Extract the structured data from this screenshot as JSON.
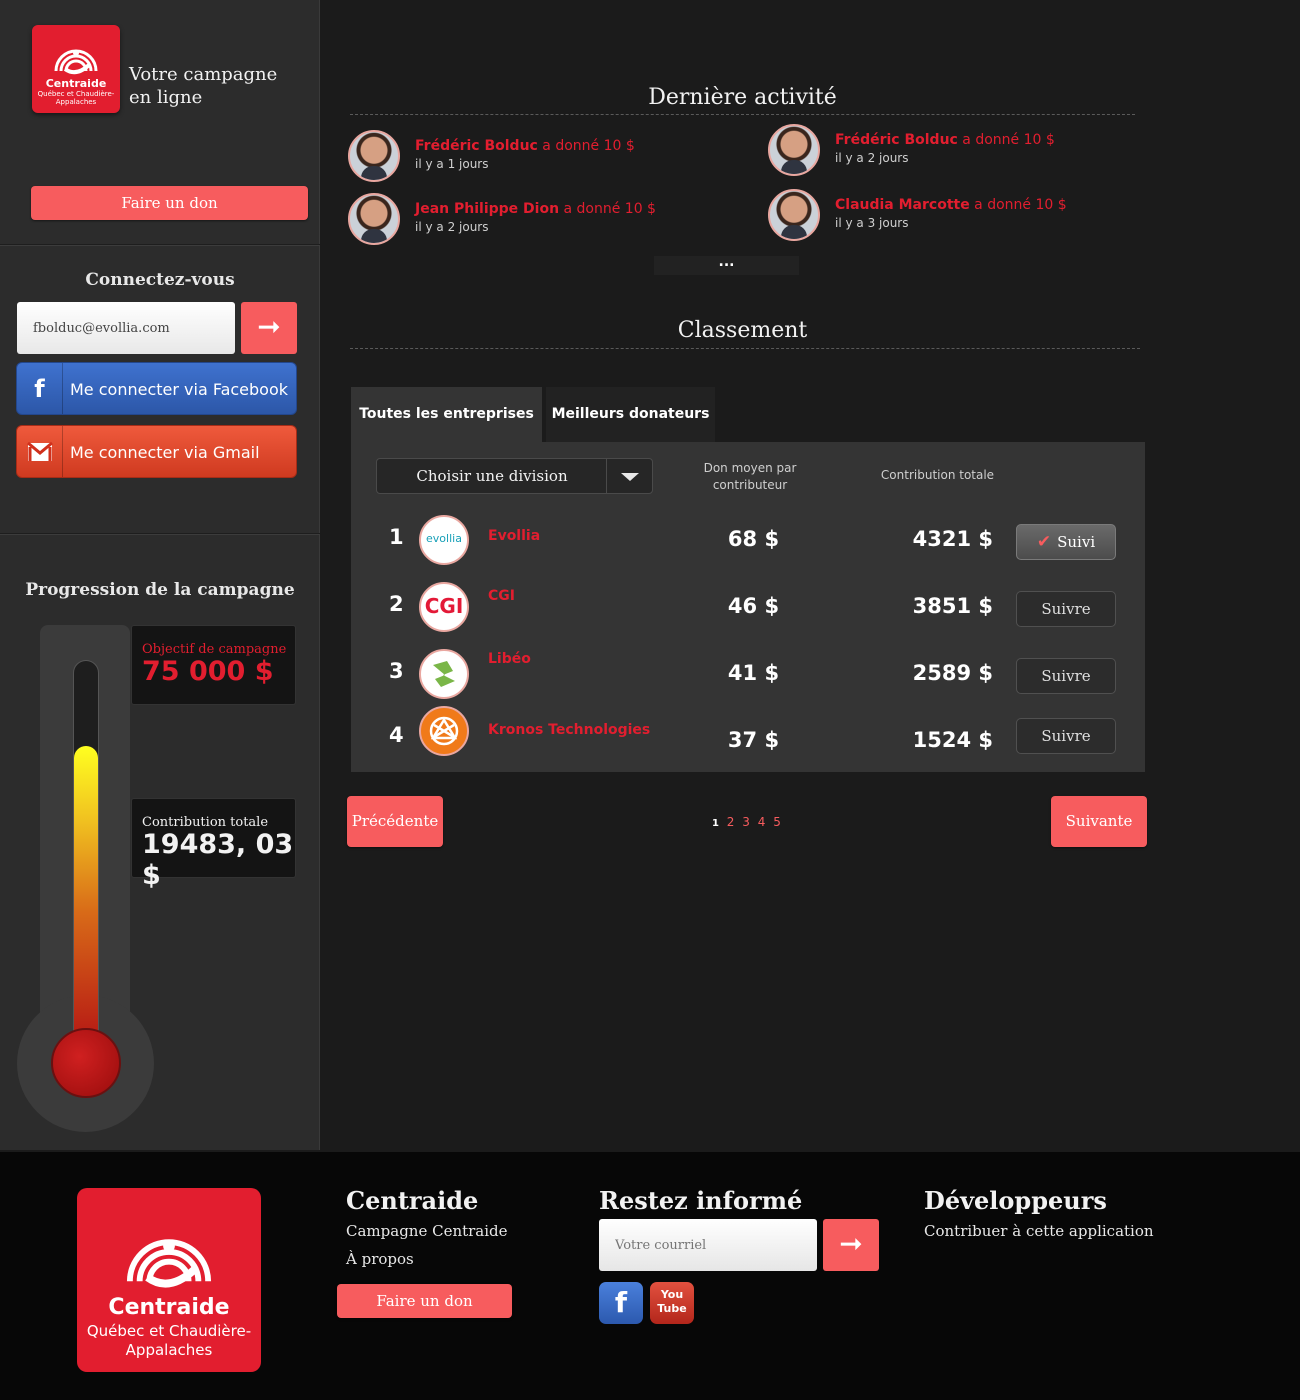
{
  "sidebar": {
    "logo": {
      "brand": "Centraide",
      "region": "Québec et Chaudière-Appalaches"
    },
    "campaign_title": "Votre campagne en ligne",
    "donate_label": "Faire un don",
    "login": {
      "title": "Connectez-vous",
      "email_value": "fbolduc@evollia.com",
      "submit_icon": "arrow-right-icon",
      "facebook_label": "Me connecter via Facebook",
      "gmail_label": "Me connecter via Gmail"
    },
    "progress": {
      "title": "Progression de la campagne",
      "goal_label": "Objectif de campagne",
      "goal_value": "75 000 $",
      "total_label": "Contribution totale",
      "total_value": "19483, 03 $",
      "fill_fraction": 0.78
    }
  },
  "activity": {
    "title": "Dernière activité",
    "items": [
      {
        "name": "Frédéric Bolduc",
        "action": " a donné 10 $",
        "when": "il y a 1 jours"
      },
      {
        "name": "Frédéric Bolduc",
        "action": " a donné 10 $",
        "when": "il y a 2 jours"
      },
      {
        "name": "Jean Philippe Dion",
        "action": " a donné 10 $",
        "when": "il y a 2 jours"
      },
      {
        "name": "Claudia Marcotte",
        "action": " a donné 10 $",
        "when": "il y a 3 jours"
      }
    ],
    "more_label": "..."
  },
  "ranking": {
    "title": "Classement",
    "tabs": [
      "Toutes les entreprises",
      "Meilleurs donateurs"
    ],
    "division_label": "Choisir une division",
    "col_avg": "Don moyen par contributeur",
    "col_total": "Contribution totale",
    "rows": [
      {
        "rank": "1",
        "name": "Evollia",
        "logo_text": "evollia",
        "avg": "68 $",
        "total": "4321 $",
        "follow": "Suivi",
        "followed": true
      },
      {
        "rank": "2",
        "name": "CGI",
        "logo_text": "CGI",
        "avg": "46 $",
        "total": "3851 $",
        "follow": "Suivre",
        "followed": false
      },
      {
        "rank": "3",
        "name": "Libéo",
        "logo_text": "",
        "avg": "41 $",
        "total": "2589 $",
        "follow": "Suivre",
        "followed": false
      },
      {
        "rank": "4",
        "name": "Kronos Technologies",
        "logo_text": "",
        "avg": "37 $",
        "total": "1524 $",
        "follow": "Suivre",
        "followed": false
      }
    ],
    "prev_label": "Précédente",
    "next_label": "Suivante",
    "pages": [
      "1",
      "2",
      "3",
      "4",
      "5"
    ],
    "current_page": "1"
  },
  "footer": {
    "logo": {
      "brand": "Centraide",
      "region": "Québec et Chaudière-Appalaches"
    },
    "col1": {
      "title": "Centraide",
      "links": [
        "Campagne Centraide",
        "À propos"
      ],
      "donate_label": "Faire un don"
    },
    "col2": {
      "title": "Restez informé",
      "email_placeholder": "Votre courriel",
      "youtube_label": "You Tube"
    },
    "col3": {
      "title": "Développeurs",
      "link": "Contribuer à cette application"
    }
  },
  "colors": {
    "accent": "#f75c5e",
    "brand_red": "#e21e2f",
    "facebook": "#3563bb",
    "gmail": "#e04a2e"
  }
}
